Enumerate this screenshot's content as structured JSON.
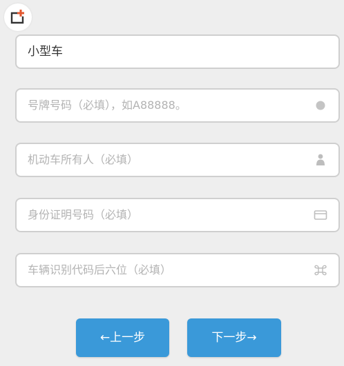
{
  "vehicle_type": {
    "value": "小型车"
  },
  "fields": [
    {
      "placeholder": "号牌号码（必填），如A88888。",
      "icon": "circle-dot-icon"
    },
    {
      "placeholder": "机动车所有人（必填）",
      "icon": "person-icon"
    },
    {
      "placeholder": "身份证明号码（必填）",
      "icon": "id-card-icon"
    },
    {
      "placeholder": "车辆识别代码后六位（必填）",
      "icon": "command-key-icon"
    }
  ],
  "buttons": {
    "prev_label": "←上一步",
    "next_label": "下一步→"
  },
  "colors": {
    "accent": "#3a99d9",
    "logo_accent": "#e2572f"
  }
}
